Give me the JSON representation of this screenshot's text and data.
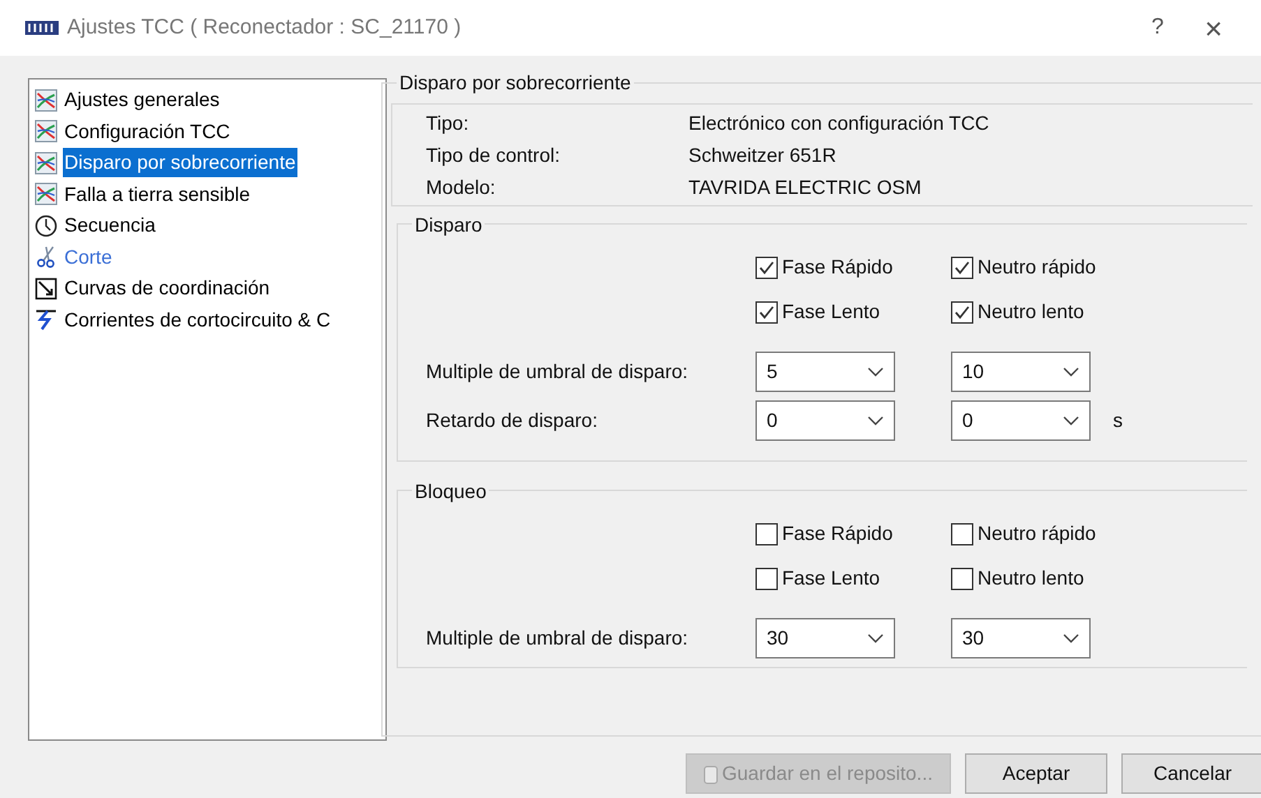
{
  "window": {
    "title": "Ajustes TCC ( Reconectador : SC_21170 )",
    "help": "?",
    "close": "×"
  },
  "sidebar": {
    "items": [
      {
        "label": "Ajustes generales",
        "kind": "chart",
        "selected": false,
        "color": "#000000"
      },
      {
        "label": "Configuración TCC",
        "kind": "chart",
        "selected": false,
        "color": "#000000"
      },
      {
        "label": "Disparo por sobrecorriente",
        "kind": "chart",
        "selected": true,
        "color": "#ffffff"
      },
      {
        "label": "Falla a tierra sensible",
        "kind": "chart",
        "selected": false,
        "color": "#000000"
      },
      {
        "label": "Secuencia",
        "kind": "clock",
        "selected": false,
        "color": "#000000"
      },
      {
        "label": "Corte",
        "kind": "scissors",
        "selected": false,
        "color": "#3b6fd6"
      },
      {
        "label": "Curvas de coordinación",
        "kind": "curves",
        "selected": false,
        "color": "#000000"
      },
      {
        "label": "Corrientes de cortocircuito & C",
        "kind": "bolt",
        "selected": false,
        "color": "#000000"
      }
    ]
  },
  "panel": {
    "title": "Disparo por sobrecorriente",
    "info": [
      {
        "label": "Tipo:",
        "value": "Electrónico con configuración TCC"
      },
      {
        "label": "Tipo de control:",
        "value": "Schweitzer 651R"
      },
      {
        "label": "Modelo:",
        "value": "TAVRIDA ELECTRIC OSM"
      }
    ],
    "groups": [
      {
        "title": "Disparo",
        "checkboxes": [
          {
            "label": "Fase Rápido",
            "checked": true
          },
          {
            "label": "Neutro rápido",
            "checked": true
          },
          {
            "label": "Fase Lento",
            "checked": true
          },
          {
            "label": "Neutro lento",
            "checked": true
          }
        ],
        "rows": [
          {
            "label": "Multiple de umbral de disparo:",
            "values": [
              "5",
              "10"
            ]
          },
          {
            "label": "Retardo de disparo:",
            "values": [
              "0",
              "0"
            ],
            "unit": "s"
          }
        ]
      },
      {
        "title": "Bloqueo",
        "checkboxes": [
          {
            "label": "Fase Rápido",
            "checked": false
          },
          {
            "label": "Neutro rápido",
            "checked": false
          },
          {
            "label": "Fase Lento",
            "checked": false
          },
          {
            "label": "Neutro lento",
            "checked": false
          }
        ],
        "rows": [
          {
            "label": "Multiple de umbral de disparo:",
            "values": [
              "30",
              "30"
            ]
          }
        ]
      }
    ]
  },
  "buttons": [
    {
      "label": "Guardar en el reposito...",
      "disabled": true
    },
    {
      "label": "Aceptar",
      "disabled": false
    },
    {
      "label": "Cancelar",
      "disabled": false
    }
  ]
}
